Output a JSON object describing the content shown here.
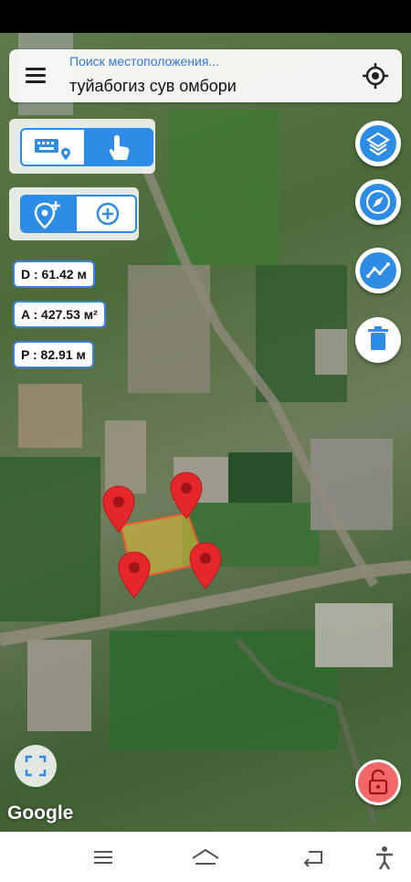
{
  "search": {
    "placeholder": "Поиск местоположения...",
    "value": "туйабогиз сув омбори"
  },
  "measurements": {
    "distance": "D : 61.42 м",
    "area": "A : 427.53 м²",
    "perimeter": "P : 82.91 м"
  },
  "map": {
    "attribution": "Google",
    "polygon_fill": "#e8c43a",
    "polygon_stroke": "#ef5a2e",
    "marker_color": "#e5262a"
  },
  "colors": {
    "accent": "#2d8ce6",
    "delete": "#2d8ce6",
    "lock": "#f06868"
  },
  "icons": {
    "menu": "menu-icon",
    "locate": "crosshair-icon",
    "keyboard": "keyboard-icon",
    "touch": "touch-icon",
    "add_marker": "add-marker-icon",
    "add": "plus-circle-icon",
    "layers": "layers-icon",
    "compass": "compass-icon",
    "chart": "line-chart-icon",
    "delete": "trash-icon",
    "fullscreen": "fullscreen-icon",
    "lock": "lock-icon"
  }
}
